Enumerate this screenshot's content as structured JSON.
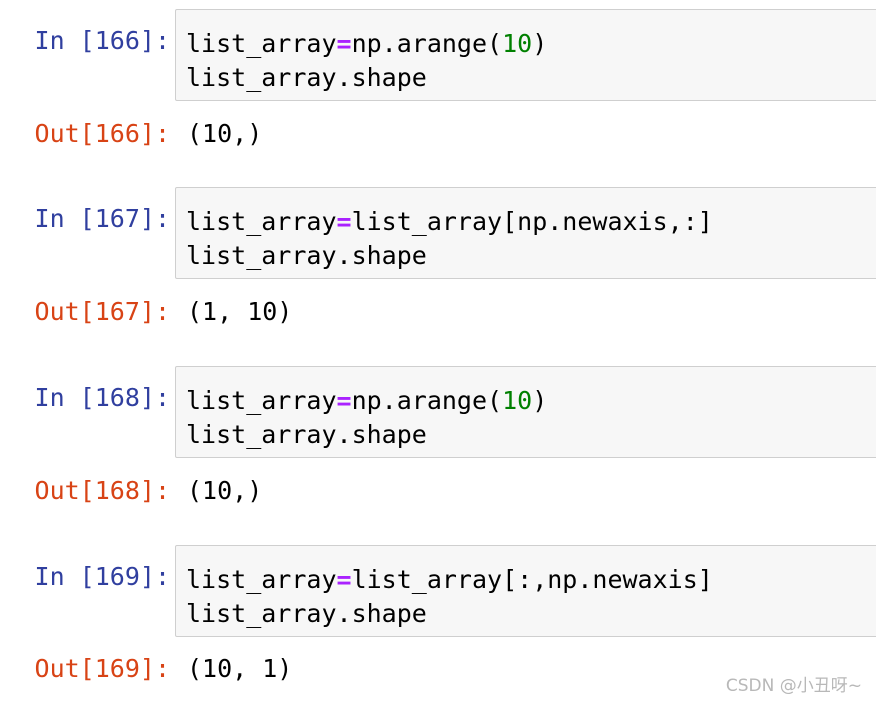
{
  "cells": [
    {
      "in_prompt": "In [166]:",
      "code": [
        {
          "a": "list_array",
          "op": "=",
          "b": "np.arange(",
          "num": "10",
          "c": ")"
        },
        {
          "text": "list_array.shape"
        }
      ],
      "out_prompt": "Out[166]:",
      "output": "(10,)"
    },
    {
      "in_prompt": "In [167]:",
      "code": [
        {
          "a": "list_array",
          "op": "=",
          "b": "list_array[np.newaxis,:]"
        },
        {
          "text": "list_array.shape"
        }
      ],
      "out_prompt": "Out[167]:",
      "output": "(1, 10)"
    },
    {
      "in_prompt": "In [168]:",
      "code": [
        {
          "a": "list_array",
          "op": "=",
          "b": "np.arange(",
          "num": "10",
          "c": ")"
        },
        {
          "text": "list_array.shape"
        }
      ],
      "out_prompt": "Out[168]:",
      "output": "(10,)"
    },
    {
      "in_prompt": "In [169]:",
      "code": [
        {
          "a": "list_array",
          "op": "=",
          "b": "list_array[:,np.newaxis]"
        },
        {
          "text": "list_array.shape"
        }
      ],
      "out_prompt": "Out[169]:",
      "output": "(10, 1)"
    }
  ],
  "watermark": "CSDN @小丑呀~",
  "colors": {
    "in_prompt": "#303f9f",
    "out_prompt": "#d84315",
    "operator": "#aa22ff",
    "number": "#008000",
    "cell_bg": "#f7f7f7",
    "cell_border": "#cfcfcf"
  }
}
